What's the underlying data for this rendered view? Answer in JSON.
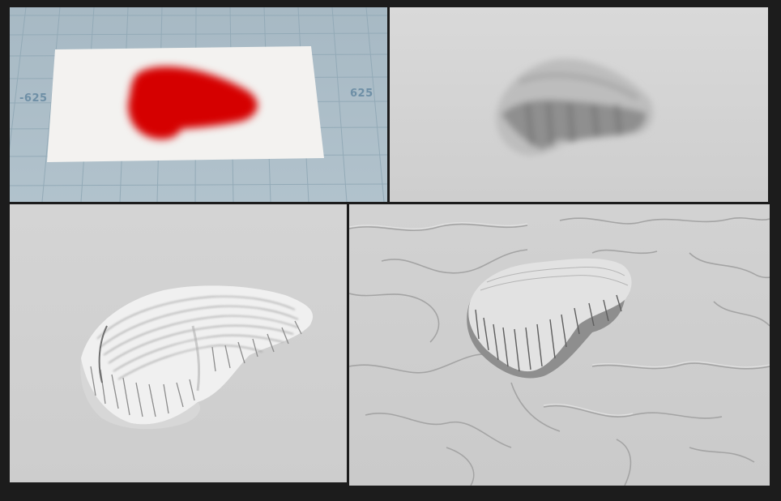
{
  "viewports": [
    {
      "name": "mask-viewport",
      "grid_labels": {
        "left": "-625",
        "right": "625"
      }
    },
    {
      "name": "blurred-heightfield-viewport"
    },
    {
      "name": "terraced-mesa-viewport"
    },
    {
      "name": "eroded-terrain-viewport"
    }
  ],
  "colors": {
    "background": "#1c1c1c",
    "grid_floor": "#a9bcc7",
    "grid_lines": "#8fa6b3",
    "mask_plane": "#f4f3f1",
    "mask_color": "#d60000",
    "render_gray": "#cfcfcf"
  }
}
